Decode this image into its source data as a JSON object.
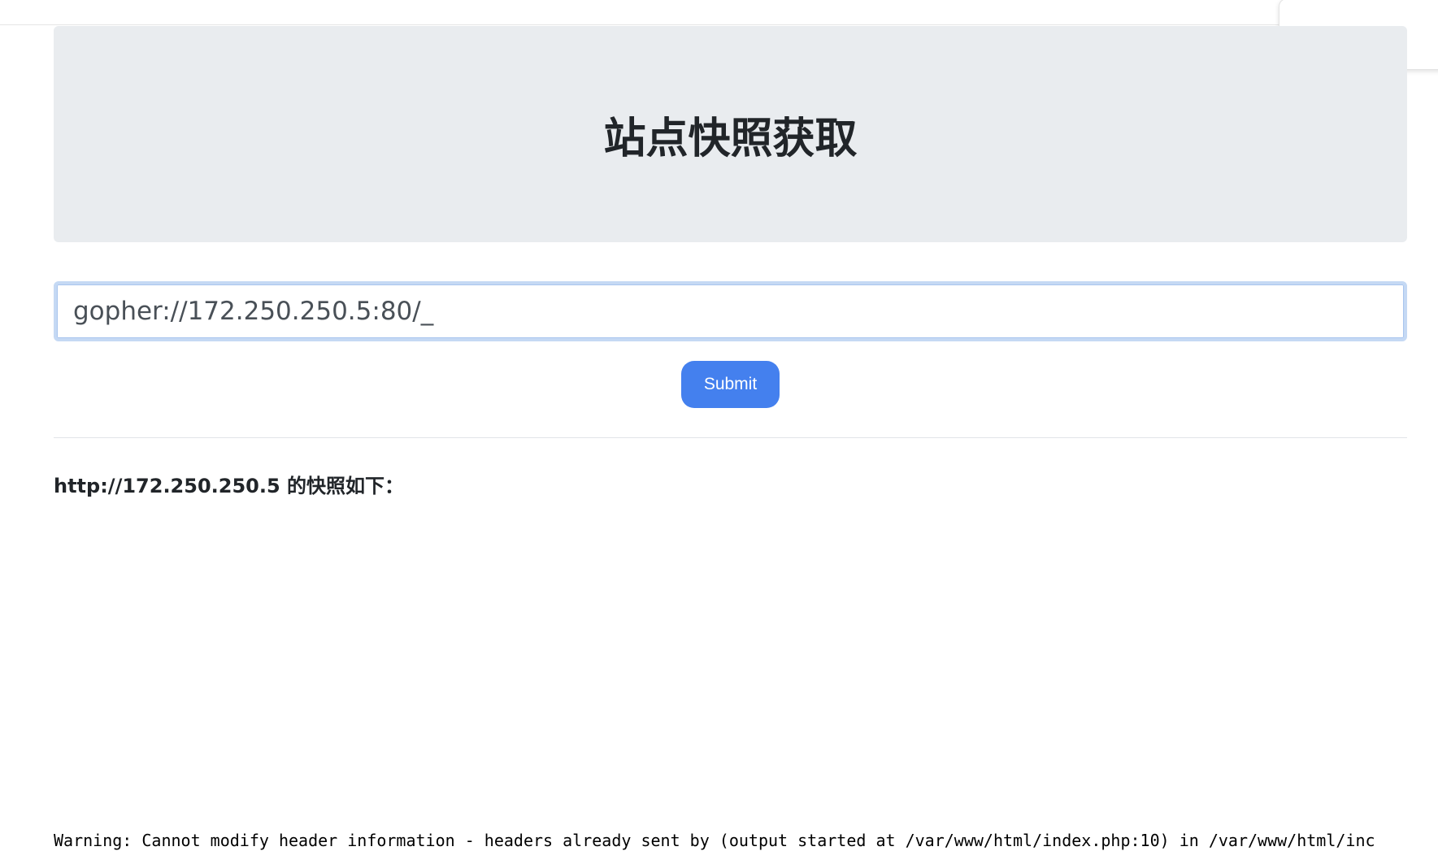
{
  "header": {
    "title": "站点快照获取"
  },
  "form": {
    "url_value": "gopher://172.250.250.5:80/_",
    "submit_label": "Submit"
  },
  "result": {
    "heading": "http://172.250.250.5 的快照如下："
  },
  "warning": {
    "text": "Warning:  Cannot modify header information - headers already sent by (output started at /var/www/html/index.php:10) in /var/www/html/inc"
  },
  "colors": {
    "jumbotron_bg": "#e9ecef",
    "submit_bg": "#4480ee",
    "input_focus_border": "#c5d9f4"
  }
}
